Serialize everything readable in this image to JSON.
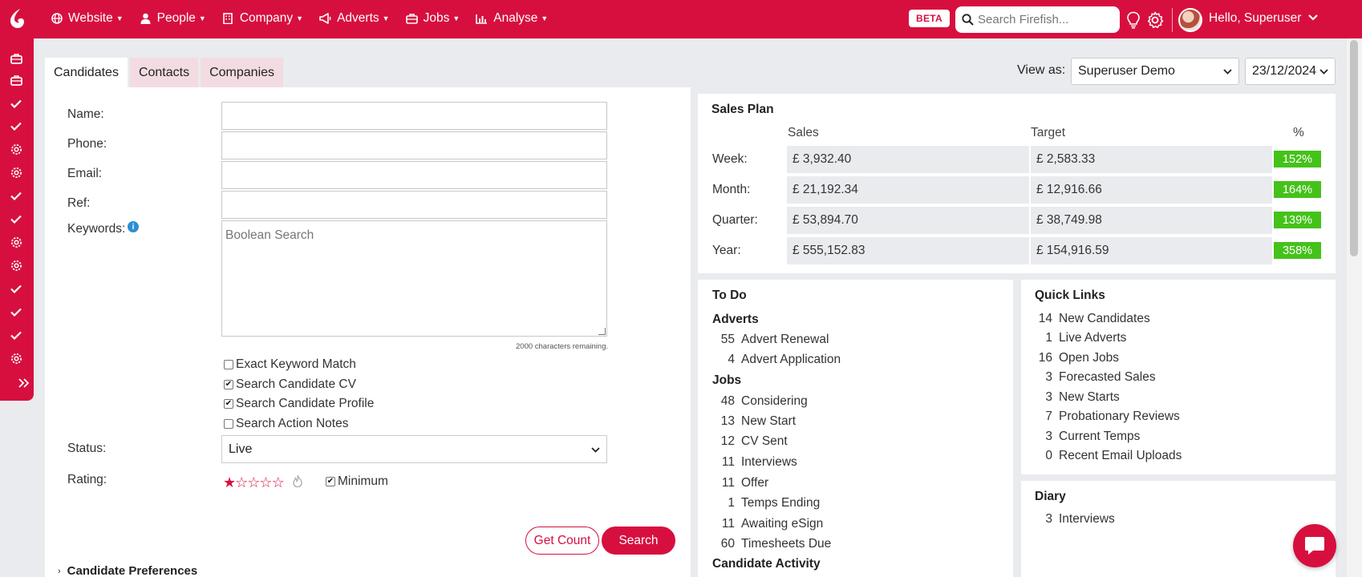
{
  "nav": {
    "items": [
      {
        "label": "Website",
        "icon": "globe-icon"
      },
      {
        "label": "People",
        "icon": "person-icon"
      },
      {
        "label": "Company",
        "icon": "building-icon"
      },
      {
        "label": "Adverts",
        "icon": "megaphone-icon"
      },
      {
        "label": "Jobs",
        "icon": "briefcase-icon"
      },
      {
        "label": "Analyse",
        "icon": "bar-chart-icon"
      }
    ],
    "beta": "BETA",
    "search_placeholder": "Search Firefish...",
    "greeting": "Hello, Superuser"
  },
  "tabs": [
    "Candidates",
    "Contacts",
    "Companies"
  ],
  "view_as": {
    "label": "View as:",
    "user": "Superuser Demo",
    "date": "23/12/2024"
  },
  "search_form": {
    "name_label": "Name:",
    "phone_label": "Phone:",
    "email_label": "Email:",
    "ref_label": "Ref:",
    "keywords_label": "Keywords:",
    "keywords_placeholder": "Boolean Search",
    "chars_remaining": "2000 characters remaining.",
    "checkboxes": [
      {
        "label": "Exact Keyword Match",
        "checked": false
      },
      {
        "label": "Search Candidate CV",
        "checked": true
      },
      {
        "label": "Search Candidate Profile",
        "checked": true
      },
      {
        "label": "Search Action Notes",
        "checked": false
      }
    ],
    "status_label": "Status:",
    "status_value": "Live",
    "rating_label": "Rating:",
    "rating_value": 1,
    "rating_max": 5,
    "minimum_label": "Minimum",
    "minimum_checked": true,
    "get_count": "Get Count",
    "search": "Search",
    "preferences": "Candidate Preferences"
  },
  "sales_plan": {
    "title": "Sales Plan",
    "headers": {
      "sales": "Sales",
      "target": "Target",
      "pct": "%"
    },
    "rows": [
      {
        "label": "Week:",
        "sales": "£ 3,932.40",
        "target": "£ 2,583.33",
        "pct": "152%"
      },
      {
        "label": "Month:",
        "sales": "£ 21,192.34",
        "target": "£ 12,916.66",
        "pct": "164%"
      },
      {
        "label": "Quarter:",
        "sales": "£ 53,894.70",
        "target": "£ 38,749.98",
        "pct": "139%"
      },
      {
        "label": "Year:",
        "sales": "£ 555,152.83",
        "target": "£ 154,916.59",
        "pct": "358%"
      }
    ]
  },
  "todo": {
    "title": "To Do",
    "adverts_title": "Adverts",
    "adverts": [
      {
        "n": "55",
        "label": "Advert Renewal"
      },
      {
        "n": "4",
        "label": "Advert Application"
      }
    ],
    "jobs_title": "Jobs",
    "jobs": [
      {
        "n": "48",
        "label": "Considering"
      },
      {
        "n": "13",
        "label": "New Start"
      },
      {
        "n": "12",
        "label": "CV Sent"
      },
      {
        "n": "11",
        "label": "Interviews"
      },
      {
        "n": "11",
        "label": "Offer"
      },
      {
        "n": "1",
        "label": "Temps Ending"
      },
      {
        "n": "11",
        "label": "Awaiting eSign"
      },
      {
        "n": "60",
        "label": "Timesheets Due"
      }
    ],
    "activity_title": "Candidate Activity"
  },
  "quick_links": {
    "title": "Quick Links",
    "items": [
      {
        "n": "14",
        "label": "New Candidates"
      },
      {
        "n": "1",
        "label": "Live Adverts"
      },
      {
        "n": "16",
        "label": "Open Jobs"
      },
      {
        "n": "3",
        "label": "Forecasted Sales"
      },
      {
        "n": "3",
        "label": "New Starts"
      },
      {
        "n": "7",
        "label": "Probationary Reviews"
      },
      {
        "n": "3",
        "label": "Current Temps"
      },
      {
        "n": "0",
        "label": "Recent Email Uploads"
      }
    ]
  },
  "diary": {
    "title": "Diary",
    "items": [
      {
        "n": "3",
        "label": "Interviews"
      }
    ]
  },
  "colors": {
    "brand": "#d70f3f",
    "pct_green": "#44c21a"
  }
}
